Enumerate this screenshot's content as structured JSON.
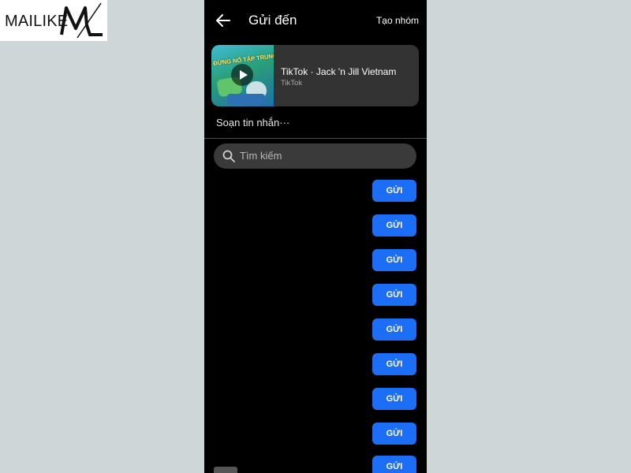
{
  "watermark": {
    "brand_text": "MAILIKE",
    "logo_mark": "ML"
  },
  "header": {
    "back_icon": "arrow-left-icon",
    "title": "Gửi đến",
    "create_group_label": "Tạo nhóm"
  },
  "share_card": {
    "thumbnail_text": "ĐỪNG NỔ TẬP TRUNG",
    "title": "TikTok · Jack 'n Jill Vietnam",
    "subtitle": "TikTok"
  },
  "compose": {
    "placeholder": "Soạn tin nhắn···"
  },
  "search": {
    "placeholder": "Tìm kiếm"
  },
  "contacts": [
    {
      "send_label": "GỬI"
    },
    {
      "send_label": "GỬI"
    },
    {
      "send_label": "GỬI"
    },
    {
      "send_label": "GỬI"
    },
    {
      "send_label": "GỬI"
    },
    {
      "send_label": "GỬI"
    },
    {
      "send_label": "GỬI"
    },
    {
      "send_label": "GỬI"
    },
    {
      "send_label": "GỬI"
    }
  ],
  "colors": {
    "send_button": "#1b6ef5",
    "screen_background": "#000000",
    "card_background": "#333333",
    "page_background": "#cfd6d7"
  }
}
